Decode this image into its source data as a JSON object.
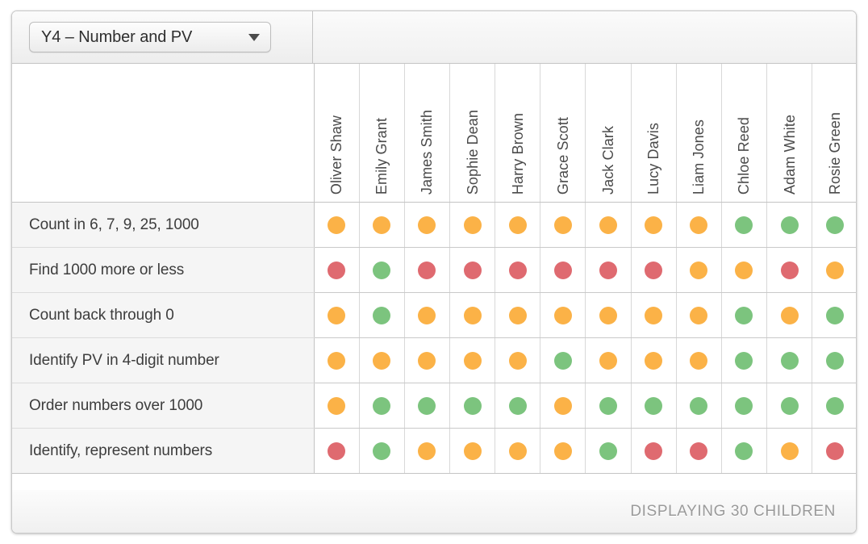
{
  "card": {
    "toolbar": {
      "class_selector": {
        "name": "class-selector",
        "label": "Y4 – Number and PV",
        "caret_icon": "chevron-down-icon"
      }
    },
    "grid": {
      "corner_label": "",
      "pupils": [
        "Oliver Shaw",
        "Emily Grant",
        "James Smith",
        "Sophie Dean",
        "Harry Brown",
        "Grace Scott",
        "Jack Clark",
        "Lucy Davis",
        "Liam Jones",
        "Chloe Reed",
        "Adam White",
        "Rosie Green"
      ],
      "status_colors": {
        "green": "#7cc47e",
        "amber": "#fbb247",
        "red": "#df6a70"
      },
      "rows": [
        {
          "objective": "Count in 6, 7, 9, 25, 1000",
          "statuses": [
            "amber",
            "amber",
            "amber",
            "amber",
            "amber",
            "amber",
            "amber",
            "amber",
            "amber",
            "green",
            "green",
            "green"
          ]
        },
        {
          "objective": "Find 1000 more or less",
          "statuses": [
            "red",
            "green",
            "red",
            "red",
            "red",
            "red",
            "red",
            "red",
            "amber",
            "amber",
            "red",
            "amber"
          ]
        },
        {
          "objective": "Count back through 0",
          "statuses": [
            "amber",
            "green",
            "amber",
            "amber",
            "amber",
            "amber",
            "amber",
            "amber",
            "amber",
            "green",
            "amber",
            "green"
          ]
        },
        {
          "objective": "Identify PV in 4-digit number",
          "statuses": [
            "amber",
            "amber",
            "amber",
            "amber",
            "amber",
            "green",
            "amber",
            "amber",
            "amber",
            "green",
            "green",
            "green"
          ]
        },
        {
          "objective": "Order numbers over 1000",
          "statuses": [
            "amber",
            "green",
            "green",
            "green",
            "green",
            "amber",
            "green",
            "green",
            "green",
            "green",
            "green",
            "green"
          ]
        },
        {
          "objective": "Identify, represent numbers",
          "statuses": [
            "red",
            "green",
            "amber",
            "amber",
            "amber",
            "amber",
            "green",
            "red",
            "red",
            "green",
            "amber",
            "red"
          ]
        }
      ]
    },
    "footer": {
      "displaying_text": "DISPLAYING 30 CHILDREN"
    }
  }
}
